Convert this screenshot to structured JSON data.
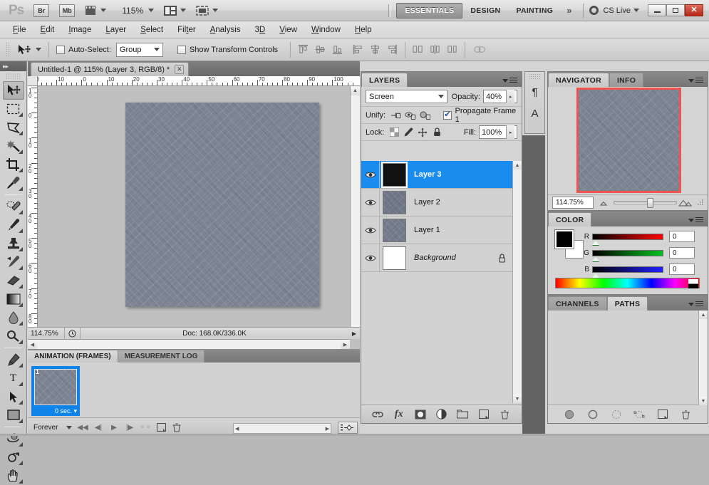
{
  "app": {
    "logo": "Ps",
    "zoom_level": "115%",
    "bridge_button": "Br",
    "minibridge_button": "Mb"
  },
  "workspace": {
    "tabs": [
      "ESSENTIALS",
      "DESIGN",
      "PAINTING"
    ],
    "active": "ESSENTIALS",
    "more": "»",
    "cs_live": "CS Live"
  },
  "window_controls": {
    "minimize": "–",
    "restore": "❐",
    "close": "✕"
  },
  "menu": [
    "File",
    "Edit",
    "Image",
    "Layer",
    "Select",
    "Filter",
    "Analysis",
    "3D",
    "View",
    "Window",
    "Help"
  ],
  "options_bar": {
    "auto_select_label": "Auto-Select:",
    "auto_select_checked": false,
    "auto_select_value": "Group",
    "show_transform_label": "Show Transform Controls",
    "show_transform_checked": false
  },
  "tools": [
    {
      "name": "move-tool",
      "selected": true
    },
    {
      "name": "rectangular-marquee-tool",
      "selected": false
    },
    {
      "name": "lasso-tool",
      "selected": false
    },
    {
      "name": "magic-wand-tool",
      "selected": false
    },
    {
      "name": "crop-tool",
      "selected": false
    },
    {
      "name": "eyedropper-tool",
      "selected": false
    },
    {
      "name": "spot-healing-brush-tool",
      "selected": false
    },
    {
      "name": "brush-tool",
      "selected": false
    },
    {
      "name": "clone-stamp-tool",
      "selected": false
    },
    {
      "name": "history-brush-tool",
      "selected": false
    },
    {
      "name": "eraser-tool",
      "selected": false
    },
    {
      "name": "gradient-tool",
      "selected": false
    },
    {
      "name": "blur-tool",
      "selected": false
    },
    {
      "name": "dodge-tool",
      "selected": false
    },
    {
      "name": "pen-tool",
      "selected": false
    },
    {
      "name": "horizontal-type-tool",
      "selected": false
    },
    {
      "name": "path-selection-tool",
      "selected": false
    },
    {
      "name": "rectangle-tool",
      "selected": false
    },
    {
      "name": "3d-object-rotate-tool",
      "selected": false
    },
    {
      "name": "3d-camera-rotate-tool",
      "selected": false
    },
    {
      "name": "hand-tool",
      "selected": false
    }
  ],
  "document": {
    "tab_title": "Untitled-1 @ 115% (Layer 3, RGB/8) *",
    "close_label": "✕",
    "ruler_h_labels": [
      "20",
      "10",
      "0",
      "10",
      "20",
      "30",
      "40",
      "50",
      "60",
      "70",
      "80",
      "90",
      "100"
    ],
    "ruler_v_labels": [
      "10",
      "0",
      "10",
      "20",
      "30",
      "40",
      "50",
      "60",
      "70",
      "80",
      "90"
    ],
    "status_zoom": "114.75%",
    "status_doc": "Doc: 168.0K/336.0K"
  },
  "animation": {
    "tabs": [
      "ANIMATION (FRAMES)",
      "MEASUREMENT LOG"
    ],
    "active_tab": "ANIMATION (FRAMES)",
    "frames": [
      {
        "number": "1",
        "duration": "0 sec."
      }
    ],
    "loop_option": "Forever"
  },
  "layers_panel": {
    "tab": "LAYERS",
    "blend_mode": "Screen",
    "opacity_label": "Opacity:",
    "opacity_value": "40%",
    "unify_label": "Unify:",
    "propagate_label": "Propagate Frame 1",
    "propagate_checked": true,
    "lock_label": "Lock:",
    "fill_label": "Fill:",
    "fill_value": "100%",
    "layers": [
      {
        "name": "Layer 3",
        "visible": true,
        "selected": true,
        "thumb_color": "#111111",
        "italic": false,
        "locked": false
      },
      {
        "name": "Layer 2",
        "visible": true,
        "selected": false,
        "thumb_color": "#6e7585",
        "italic": false,
        "locked": false
      },
      {
        "name": "Layer 1",
        "visible": true,
        "selected": false,
        "thumb_color": "#727a89",
        "italic": false,
        "locked": false
      },
      {
        "name": "Background",
        "visible": true,
        "selected": false,
        "thumb_color": "#ffffff",
        "italic": true,
        "locked": true
      }
    ]
  },
  "icon_dock": {
    "paragraph": "¶",
    "character": "A"
  },
  "navigator": {
    "tabs": [
      "NAVIGATOR",
      "INFO"
    ],
    "active_tab": "NAVIGATOR",
    "zoom_value": "114.75%",
    "view_box_color": "#ef5350"
  },
  "color_panel": {
    "tab": "COLOR",
    "foreground": "#000000",
    "background": "#ffffff",
    "channels": [
      {
        "label": "R",
        "value": "0",
        "color": "#ff0000"
      },
      {
        "label": "G",
        "value": "0",
        "color": "#00c020"
      },
      {
        "label": "B",
        "value": "0",
        "color": "#2020ff"
      }
    ]
  },
  "paths_panel": {
    "tabs": [
      "CHANNELS",
      "PATHS"
    ],
    "active_tab": "PATHS"
  },
  "canvas": {
    "artboard_color": "#7b8291"
  }
}
